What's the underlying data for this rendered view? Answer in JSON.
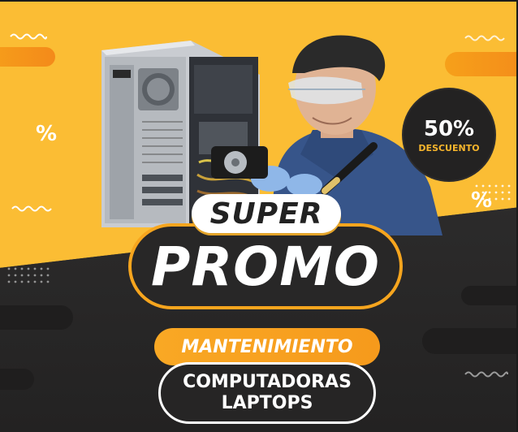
{
  "promo": {
    "badge_value": "50%",
    "badge_label": "DESCUENTO",
    "super": "SUPER",
    "promo": "PROMO",
    "service": "MANTENIMIENTO",
    "line1": "COMPUTADORAS",
    "line2": "LAPTOPS",
    "percent_left": "%",
    "percent_right": "%"
  },
  "colors": {
    "yellow": "#fbbd34",
    "orange": "#f7931e",
    "dark": "#2e2d2d",
    "white": "#ffffff"
  },
  "icons": {
    "photo": "technician-repairing-pc-image"
  }
}
